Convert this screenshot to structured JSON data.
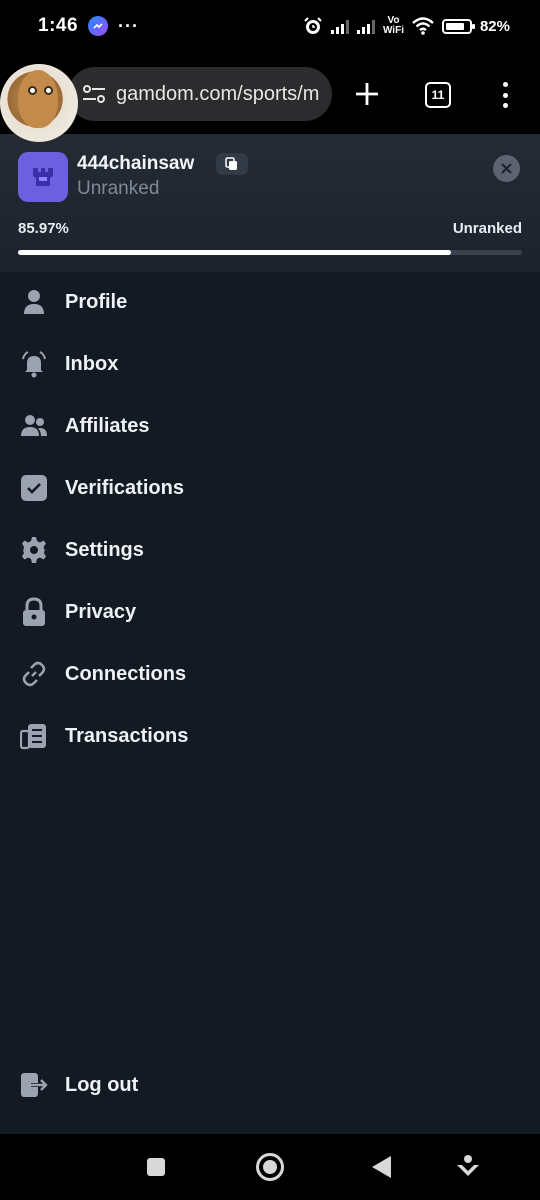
{
  "status_bar": {
    "time": "1:46",
    "dots": "···",
    "vo": "Vo",
    "wifi_label": "WiFi",
    "battery": "82%",
    "battery_level": 0.82
  },
  "browser": {
    "url": "gamdom.com/sports/m",
    "tab_count": "11"
  },
  "profile": {
    "username": "444chainsaw",
    "rank": "Unranked",
    "progress_label": "85.97%",
    "progress_value": 0.8597,
    "next_rank": "Unranked",
    "badge_color": "#6c5fe0"
  },
  "menu": {
    "items": [
      {
        "label": "Profile",
        "icon": "user-icon"
      },
      {
        "label": "Inbox",
        "icon": "bell-icon"
      },
      {
        "label": "Affiliates",
        "icon": "users-icon"
      },
      {
        "label": "Verifications",
        "icon": "check-square-icon"
      },
      {
        "label": "Settings",
        "icon": "gear-icon"
      },
      {
        "label": "Privacy",
        "icon": "lock-icon"
      },
      {
        "label": "Connections",
        "icon": "link-icon"
      },
      {
        "label": "Transactions",
        "icon": "receipt-icon"
      }
    ],
    "logout_label": "Log out"
  },
  "colors": {
    "background": "#141a23",
    "header": "#242b35",
    "icon": "#9aa3af"
  }
}
